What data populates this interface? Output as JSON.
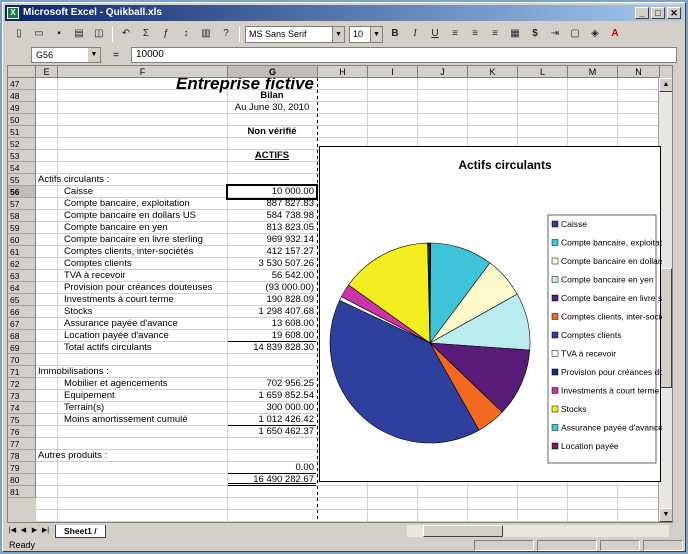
{
  "window": {
    "title": "Microsoft Excel - Quikball.xls",
    "controls": [
      "_",
      "□",
      "✕"
    ]
  },
  "toolbar": {
    "font_name": "MS Sans Serif",
    "font_size": "10",
    "bold": "B",
    "italic": "I",
    "underline": "U",
    "currency": "$"
  },
  "formula_bar": {
    "name_box": "G56",
    "equals": "=",
    "formula": "10000"
  },
  "columns": [
    "E",
    "F",
    "G",
    "H",
    "I",
    "J",
    "K",
    "L",
    "M",
    "N"
  ],
  "rows": [
    "47",
    "48",
    "49",
    "50",
    "51",
    "52",
    "53",
    "54",
    "55",
    "56",
    "57",
    "58",
    "59",
    "60",
    "61",
    "62",
    "63",
    "64",
    "65",
    "66",
    "67",
    "68",
    "69",
    "70",
    "71",
    "72",
    "73",
    "74",
    "75",
    "76",
    "77",
    "78",
    "79",
    "80",
    "81"
  ],
  "sheet": {
    "title": "Entreprise fictive",
    "subtitle": "Bilan",
    "date": "Au June 30, 2010",
    "status": "Non vérifié",
    "section": "ACTIFS",
    "current_header": "Actifs circulants :",
    "current_items": [
      {
        "label": "Caisse",
        "value": "10 000.00"
      },
      {
        "label": "Compte bancaire, exploitation",
        "value": "887 827.83"
      },
      {
        "label": "Compte bancaire en dollars US",
        "value": "584 738.98"
      },
      {
        "label": "Compte bancaire en yen",
        "value": "813 823.05"
      },
      {
        "label": "Compte bancaire en livre sterling",
        "value": "969 932.14"
      },
      {
        "label": "Comptes clients, inter-sociétés",
        "value": "412 157.27"
      },
      {
        "label": "Comptes clients",
        "value": "3 530 507.26"
      },
      {
        "label": "TVA à recevoir",
        "value": "56 542.00"
      },
      {
        "label": "Provision pour créances douteuses",
        "value": "(93 000.00)"
      },
      {
        "label": "Investments à court terme",
        "value": "190 828.09"
      },
      {
        "label": "Stocks",
        "value": "1 298 407.68"
      },
      {
        "label": "Assurance payée d'avance",
        "value": "13 608.00"
      },
      {
        "label": "Location payée d'avance",
        "value": "19 608.00"
      }
    ],
    "current_total_label": "Total actifs circulants",
    "current_total": "14 839 828.30",
    "fixed_header": "Immobilisations :",
    "fixed_items": [
      {
        "label": "Mobilier et agencements",
        "value": "702 956.25"
      },
      {
        "label": "Equipement",
        "value": "1 659 852.54"
      },
      {
        "label": "Terrain(s)",
        "value": "300 000.00"
      },
      {
        "label": "Moins amortissement cumulé",
        "value": "1 012 426.42"
      }
    ],
    "fixed_total": "1 650 462.37",
    "other_header": "Autres produits :",
    "other_value": "0.00",
    "grand_total": "16 490 282.67"
  },
  "chart_data": {
    "type": "pie",
    "title": "Actifs circulants",
    "legend": "right",
    "slices": [
      {
        "label": "Caisse",
        "value": 10000.0,
        "color": "#2e3f9e"
      },
      {
        "label": "Compte bancaire, exploitation",
        "value": 887827.83,
        "color": "#3ec4d8"
      },
      {
        "label": "Compte bancaire en dollars US",
        "value": 584738.98,
        "color": "#fffacc"
      },
      {
        "label": "Compte bancaire en yen",
        "value": 813823.05,
        "color": "#b8ecef"
      },
      {
        "label": "Compte bancaire en livre sterling",
        "value": 969932.14,
        "color": "#5a1a7a"
      },
      {
        "label": "Comptes clients, inter-sociétés",
        "value": 412157.27,
        "color": "#f06a20"
      },
      {
        "label": "Comptes clients",
        "value": 3530507.26,
        "color": "#2e3f9e"
      },
      {
        "label": "TVA à recevoir",
        "value": 56542.0,
        "color": "#ffffff"
      },
      {
        "label": "Provision pour créances douteuses",
        "value": 0,
        "color": "#1b2a7a"
      },
      {
        "label": "Investments à court terme",
        "value": 190828.09,
        "color": "#cc33aa"
      },
      {
        "label": "Stocks",
        "value": 1298407.68,
        "color": "#f2ee20"
      },
      {
        "label": "Assurance payée d'avance",
        "value": 13608.0,
        "color": "#3ec4d8"
      },
      {
        "label": "Location payée",
        "value": 19608.0,
        "color": "#7a1a5a"
      }
    ]
  },
  "sheet_tabs": {
    "active": "Sheet1 /"
  },
  "status": "Ready"
}
